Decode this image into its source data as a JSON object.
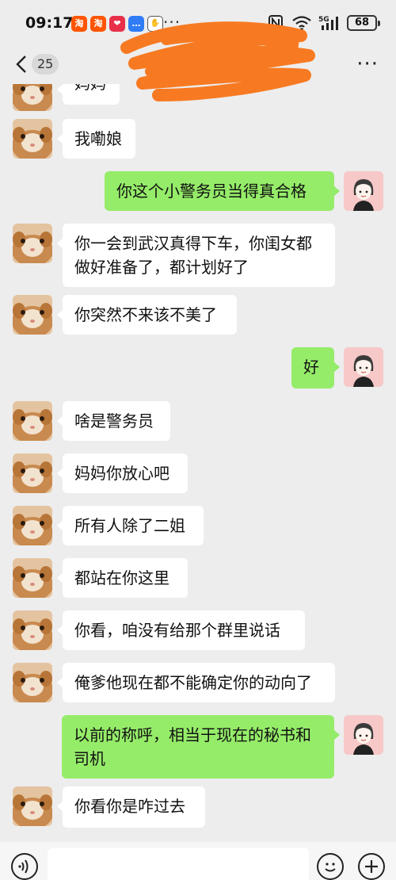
{
  "status_bar": {
    "time": "09:17",
    "app_icons": [
      {
        "name": "taobao-icon",
        "glyph": "淘",
        "color": "#ff5500"
      },
      {
        "name": "taobao-icon",
        "glyph": "淘",
        "color": "#ff5500"
      },
      {
        "name": "health-icon",
        "glyph": "❤",
        "color": "#e8304a"
      },
      {
        "name": "chat-app-icon",
        "glyph": "…",
        "color": "#2f7cf6"
      },
      {
        "name": "hand-icon",
        "glyph": "✋",
        "color": "#777777"
      }
    ],
    "more": "···",
    "network_label": "5G",
    "battery": "68"
  },
  "header": {
    "unread_count": "25",
    "menu": "···"
  },
  "messages": [
    {
      "side": "in",
      "text": "妈妈"
    },
    {
      "side": "in",
      "text": "我嘞娘"
    },
    {
      "side": "out",
      "text": "你这个小警务员当得真合格"
    },
    {
      "side": "in",
      "text": "你一会到武汉真得下车，你闺女都\n做好准备了，都计划好了"
    },
    {
      "side": "in",
      "text": "你突然不来该不美了"
    },
    {
      "side": "out",
      "text": "好"
    },
    {
      "side": "in",
      "text": "啥是警务员"
    },
    {
      "side": "in",
      "text": "妈妈你放心吧"
    },
    {
      "side": "in",
      "text": "所有人除了二姐"
    },
    {
      "side": "in",
      "text": "都站在你这里"
    },
    {
      "side": "in",
      "text": "你看，咱没有给那个群里说话"
    },
    {
      "side": "in",
      "text": "俺爹他现在都不能确定你的动向了"
    },
    {
      "side": "out",
      "text": "以前的称呼，相当于现在的秘书和\n司机"
    },
    {
      "side": "in",
      "text": "你看你是咋过去"
    }
  ],
  "input": {
    "placeholder": ""
  },
  "colors": {
    "background": "#ededed",
    "incoming_bubble": "#ffffff",
    "outgoing_bubble": "#95ec69",
    "redaction": "#f77a22"
  }
}
